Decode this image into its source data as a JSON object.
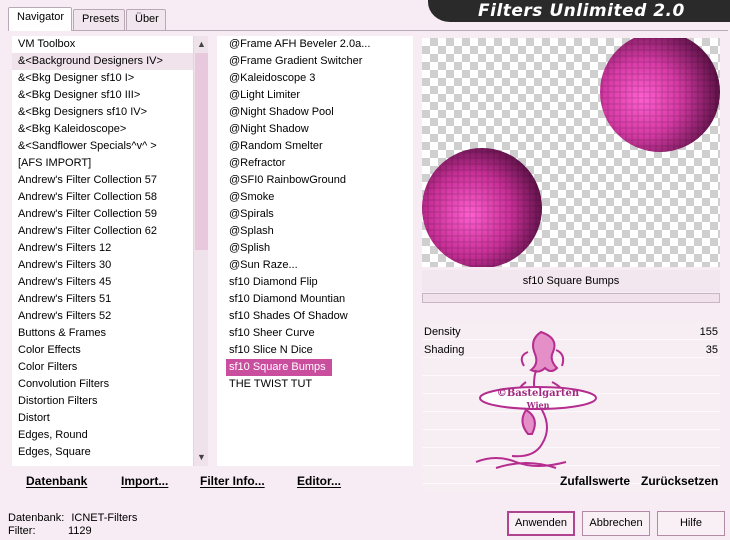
{
  "app": {
    "title": "Filters Unlimited 2.0"
  },
  "tabs": [
    {
      "label": "Navigator",
      "active": true
    },
    {
      "label": "Presets",
      "active": false
    },
    {
      "label": "Über",
      "active": false
    }
  ],
  "categories": [
    {
      "label": "VM Toolbox"
    },
    {
      "label": "&<Background Designers IV>",
      "selected": true
    },
    {
      "label": "&<Bkg Designer sf10 I>"
    },
    {
      "label": "&<Bkg Designer sf10 III>"
    },
    {
      "label": "&<Bkg Designers sf10 IV>"
    },
    {
      "label": "&<Bkg Kaleidoscope>"
    },
    {
      "label": "&<Sandflower Specials^v^ >"
    },
    {
      "label": "[AFS IMPORT]"
    },
    {
      "label": "Andrew's Filter Collection 57"
    },
    {
      "label": "Andrew's Filter Collection 58"
    },
    {
      "label": "Andrew's Filter Collection 59"
    },
    {
      "label": "Andrew's Filter Collection 62"
    },
    {
      "label": "Andrew's Filters 12"
    },
    {
      "label": "Andrew's Filters 30"
    },
    {
      "label": "Andrew's Filters 45"
    },
    {
      "label": "Andrew's Filters 51"
    },
    {
      "label": "Andrew's Filters 52"
    },
    {
      "label": "Buttons & Frames"
    },
    {
      "label": "Color Effects"
    },
    {
      "label": "Color Filters"
    },
    {
      "label": "Convolution Filters"
    },
    {
      "label": "Distortion Filters"
    },
    {
      "label": "Distort"
    },
    {
      "label": "Edges, Round"
    },
    {
      "label": "Edges, Square"
    }
  ],
  "filters": [
    {
      "label": "@Frame AFH Beveler 2.0a..."
    },
    {
      "label": "@Frame Gradient Switcher"
    },
    {
      "label": "@Kaleidoscope 3"
    },
    {
      "label": "@Light Limiter"
    },
    {
      "label": "@Night Shadow Pool"
    },
    {
      "label": "@Night Shadow"
    },
    {
      "label": "@Random Smelter"
    },
    {
      "label": "@Refractor"
    },
    {
      "label": "@SFI0 RainbowGround"
    },
    {
      "label": "@Smoke"
    },
    {
      "label": "@Spirals"
    },
    {
      "label": "@Splash"
    },
    {
      "label": "@Splish"
    },
    {
      "label": "@Sun Raze..."
    },
    {
      "label": "sf10 Diamond Flip"
    },
    {
      "label": "sf10 Diamond Mountian"
    },
    {
      "label": "sf10 Shades Of Shadow"
    },
    {
      "label": "sf10 Sheer Curve"
    },
    {
      "label": "sf10 Slice N Dice"
    },
    {
      "label": "sf10 Square Bumps",
      "selected": true
    },
    {
      "label": "THE TWIST TUT"
    }
  ],
  "bottom_actions": {
    "datenbank": "Datenbank",
    "import": "Import...",
    "filter_info": "Filter Info...",
    "editor": "Editor..."
  },
  "preview": {
    "filter_name": "sf10 Square Bumps",
    "accent_color": "#d63aa5",
    "watermark_text_1": "©Bastelgarten",
    "watermark_text_2": "Wien"
  },
  "params": [
    {
      "name": "Density",
      "value": "155"
    },
    {
      "name": "Shading",
      "value": "35"
    }
  ],
  "param_actions": {
    "random": "Zufallswerte",
    "reset": "Zurücksetzen"
  },
  "status": {
    "db_label": "Datenbank:",
    "db_value": "ICNET-Filters",
    "filter_label": "Filter:",
    "filter_value": "1129"
  },
  "buttons": {
    "apply": "Anwenden",
    "cancel": "Abbrechen",
    "help": "Hilfe"
  }
}
